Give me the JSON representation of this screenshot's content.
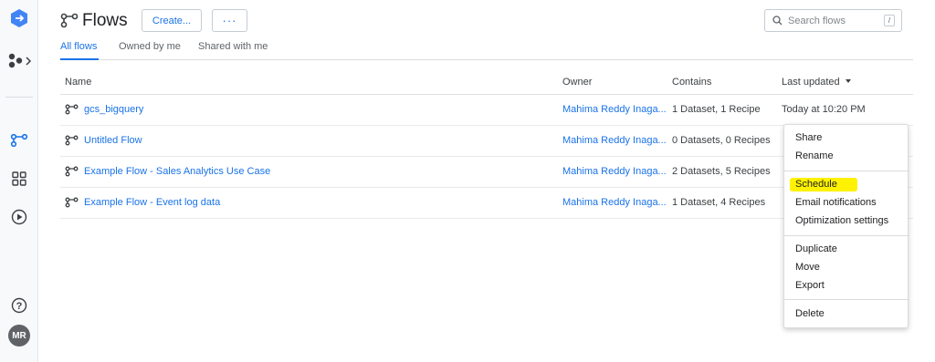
{
  "nav": {
    "items": [
      {
        "icon": "dataprep-logo-icon"
      },
      {
        "icon": "data-sources-expand-icon"
      },
      {
        "icon": "flows-icon"
      },
      {
        "icon": "library-grid-icon"
      },
      {
        "icon": "jobs-play-icon"
      },
      {
        "icon": "help-icon"
      }
    ],
    "avatar": "MR"
  },
  "header": {
    "title": "Flows",
    "create_label": "Create...",
    "more_label": "···",
    "search_placeholder": "Search flows",
    "search_shortcut": "/"
  },
  "tabs": [
    {
      "label": "All flows",
      "active": true
    },
    {
      "label": "Owned by me",
      "active": false
    },
    {
      "label": "Shared with me",
      "active": false
    }
  ],
  "table": {
    "columns": [
      "Name",
      "Owner",
      "Contains",
      "Last updated"
    ],
    "rows": [
      {
        "name": "gcs_bigquery",
        "owner": "Mahima Reddy Inaga...",
        "contains": "1 Dataset, 1 Recipe",
        "updated": "Today at 10:20 PM"
      },
      {
        "name": "Untitled Flow",
        "owner": "Mahima Reddy Inaga...",
        "contains": "0 Datasets, 0 Recipes",
        "updated": ""
      },
      {
        "name": "Example Flow - Sales Analytics Use Case",
        "owner": "Mahima Reddy Inaga...",
        "contains": "2 Datasets, 5 Recipes",
        "updated": ""
      },
      {
        "name": "Example Flow - Event log data",
        "owner": "Mahima Reddy Inaga...",
        "contains": "1 Dataset, 4 Recipes",
        "updated": ""
      }
    ]
  },
  "context_menu": {
    "groups": [
      [
        "Share",
        "Rename"
      ],
      [
        "Schedule",
        "Email notifications",
        "Optimization settings"
      ],
      [
        "Duplicate",
        "Move",
        "Export"
      ],
      [
        "Delete"
      ]
    ],
    "highlighted": "Schedule"
  },
  "colors": {
    "accent": "#1a73e8",
    "highlight": "#fff200",
    "logo": "#4285f4"
  }
}
